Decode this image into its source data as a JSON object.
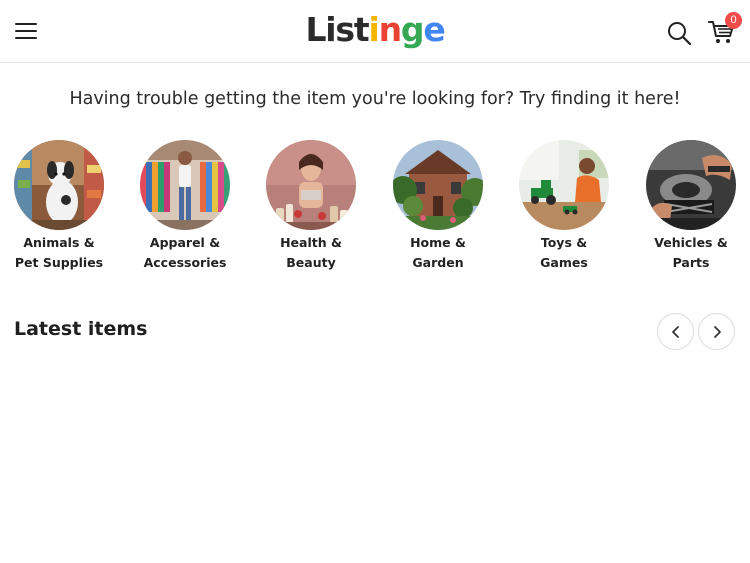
{
  "header": {
    "logo": {
      "part1": "List",
      "part2": "i",
      "part3": "n",
      "part4": "g",
      "part5": "e"
    },
    "cart_count": "0"
  },
  "tagline": "Having trouble getting the item you're looking for? Try finding it here!",
  "categories": [
    {
      "line1": "Animals &",
      "line2": "Pet Supplies"
    },
    {
      "line1": "Apparel &",
      "line2": "Accessories"
    },
    {
      "line1": "Health &",
      "line2": "Beauty"
    },
    {
      "line1": "Home &",
      "line2": "Garden"
    },
    {
      "line1": "Toys &",
      "line2": "Games"
    },
    {
      "line1": "Vehicles &",
      "line2": "Parts"
    }
  ],
  "latest": {
    "title": "Latest items"
  },
  "colors": {
    "badge": "#f04c4c",
    "logo_yellow": "#f4b400",
    "logo_red": "#ea4335",
    "logo_green": "#34a853",
    "logo_blue": "#4285f4"
  },
  "icons": [
    "menu-icon",
    "search-icon",
    "cart-icon",
    "chevron-left-icon",
    "chevron-right-icon"
  ]
}
